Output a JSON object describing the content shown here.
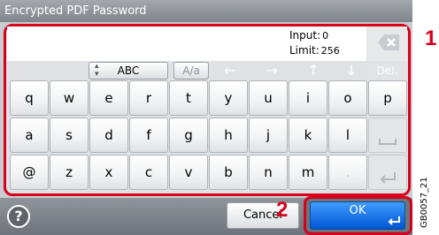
{
  "window": {
    "title": "Encrypted PDF Password"
  },
  "input": {
    "input_label": "Input:",
    "input_count": "0",
    "limit_label": "Limit:",
    "limit_count": "256"
  },
  "controls": {
    "mode_select": "ABC",
    "case_toggle": "A/a",
    "delete_label": "Del."
  },
  "keys": {
    "row1": [
      "q",
      "w",
      "e",
      "r",
      "t",
      "y",
      "u",
      "i",
      "o",
      "p"
    ],
    "row2": [
      "a",
      "s",
      "d",
      "f",
      "g",
      "h",
      "j",
      "k",
      "l"
    ],
    "row3": [
      "@",
      "z",
      "x",
      "c",
      "v",
      "b",
      "n",
      "m",
      "."
    ]
  },
  "footer": {
    "help": "?",
    "cancel": "Cancel",
    "ok": "OK"
  },
  "callouts": {
    "one": "1",
    "two": "2"
  },
  "figure_id": "GB0057_21",
  "colors": {
    "highlight": "#d6001c",
    "ok_button": "#0055d4",
    "title_bar": "#8e9398"
  }
}
